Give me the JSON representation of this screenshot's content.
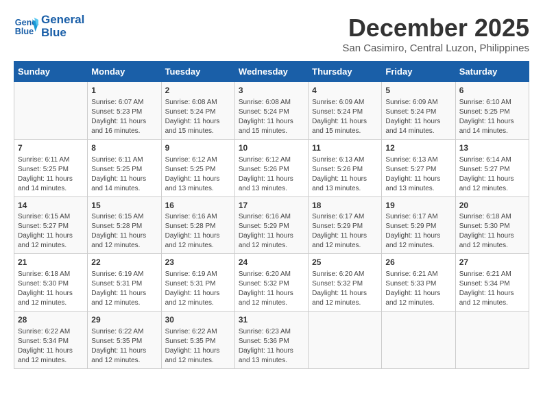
{
  "header": {
    "logo_line1": "General",
    "logo_line2": "Blue",
    "month": "December 2025",
    "location": "San Casimiro, Central Luzon, Philippines"
  },
  "days_of_week": [
    "Sunday",
    "Monday",
    "Tuesday",
    "Wednesday",
    "Thursday",
    "Friday",
    "Saturday"
  ],
  "weeks": [
    [
      {
        "day": "",
        "info": ""
      },
      {
        "day": "1",
        "info": "Sunrise: 6:07 AM\nSunset: 5:23 PM\nDaylight: 11 hours\nand 16 minutes."
      },
      {
        "day": "2",
        "info": "Sunrise: 6:08 AM\nSunset: 5:24 PM\nDaylight: 11 hours\nand 15 minutes."
      },
      {
        "day": "3",
        "info": "Sunrise: 6:08 AM\nSunset: 5:24 PM\nDaylight: 11 hours\nand 15 minutes."
      },
      {
        "day": "4",
        "info": "Sunrise: 6:09 AM\nSunset: 5:24 PM\nDaylight: 11 hours\nand 15 minutes."
      },
      {
        "day": "5",
        "info": "Sunrise: 6:09 AM\nSunset: 5:24 PM\nDaylight: 11 hours\nand 14 minutes."
      },
      {
        "day": "6",
        "info": "Sunrise: 6:10 AM\nSunset: 5:25 PM\nDaylight: 11 hours\nand 14 minutes."
      }
    ],
    [
      {
        "day": "7",
        "info": "Sunrise: 6:11 AM\nSunset: 5:25 PM\nDaylight: 11 hours\nand 14 minutes."
      },
      {
        "day": "8",
        "info": "Sunrise: 6:11 AM\nSunset: 5:25 PM\nDaylight: 11 hours\nand 14 minutes."
      },
      {
        "day": "9",
        "info": "Sunrise: 6:12 AM\nSunset: 5:25 PM\nDaylight: 11 hours\nand 13 minutes."
      },
      {
        "day": "10",
        "info": "Sunrise: 6:12 AM\nSunset: 5:26 PM\nDaylight: 11 hours\nand 13 minutes."
      },
      {
        "day": "11",
        "info": "Sunrise: 6:13 AM\nSunset: 5:26 PM\nDaylight: 11 hours\nand 13 minutes."
      },
      {
        "day": "12",
        "info": "Sunrise: 6:13 AM\nSunset: 5:27 PM\nDaylight: 11 hours\nand 13 minutes."
      },
      {
        "day": "13",
        "info": "Sunrise: 6:14 AM\nSunset: 5:27 PM\nDaylight: 11 hours\nand 12 minutes."
      }
    ],
    [
      {
        "day": "14",
        "info": "Sunrise: 6:15 AM\nSunset: 5:27 PM\nDaylight: 11 hours\nand 12 minutes."
      },
      {
        "day": "15",
        "info": "Sunrise: 6:15 AM\nSunset: 5:28 PM\nDaylight: 11 hours\nand 12 minutes."
      },
      {
        "day": "16",
        "info": "Sunrise: 6:16 AM\nSunset: 5:28 PM\nDaylight: 11 hours\nand 12 minutes."
      },
      {
        "day": "17",
        "info": "Sunrise: 6:16 AM\nSunset: 5:29 PM\nDaylight: 11 hours\nand 12 minutes."
      },
      {
        "day": "18",
        "info": "Sunrise: 6:17 AM\nSunset: 5:29 PM\nDaylight: 11 hours\nand 12 minutes."
      },
      {
        "day": "19",
        "info": "Sunrise: 6:17 AM\nSunset: 5:29 PM\nDaylight: 11 hours\nand 12 minutes."
      },
      {
        "day": "20",
        "info": "Sunrise: 6:18 AM\nSunset: 5:30 PM\nDaylight: 11 hours\nand 12 minutes."
      }
    ],
    [
      {
        "day": "21",
        "info": "Sunrise: 6:18 AM\nSunset: 5:30 PM\nDaylight: 11 hours\nand 12 minutes."
      },
      {
        "day": "22",
        "info": "Sunrise: 6:19 AM\nSunset: 5:31 PM\nDaylight: 11 hours\nand 12 minutes."
      },
      {
        "day": "23",
        "info": "Sunrise: 6:19 AM\nSunset: 5:31 PM\nDaylight: 11 hours\nand 12 minutes."
      },
      {
        "day": "24",
        "info": "Sunrise: 6:20 AM\nSunset: 5:32 PM\nDaylight: 11 hours\nand 12 minutes."
      },
      {
        "day": "25",
        "info": "Sunrise: 6:20 AM\nSunset: 5:32 PM\nDaylight: 11 hours\nand 12 minutes."
      },
      {
        "day": "26",
        "info": "Sunrise: 6:21 AM\nSunset: 5:33 PM\nDaylight: 11 hours\nand 12 minutes."
      },
      {
        "day": "27",
        "info": "Sunrise: 6:21 AM\nSunset: 5:34 PM\nDaylight: 11 hours\nand 12 minutes."
      }
    ],
    [
      {
        "day": "28",
        "info": "Sunrise: 6:22 AM\nSunset: 5:34 PM\nDaylight: 11 hours\nand 12 minutes."
      },
      {
        "day": "29",
        "info": "Sunrise: 6:22 AM\nSunset: 5:35 PM\nDaylight: 11 hours\nand 12 minutes."
      },
      {
        "day": "30",
        "info": "Sunrise: 6:22 AM\nSunset: 5:35 PM\nDaylight: 11 hours\nand 12 minutes."
      },
      {
        "day": "31",
        "info": "Sunrise: 6:23 AM\nSunset: 5:36 PM\nDaylight: 11 hours\nand 13 minutes."
      },
      {
        "day": "",
        "info": ""
      },
      {
        "day": "",
        "info": ""
      },
      {
        "day": "",
        "info": ""
      }
    ]
  ]
}
